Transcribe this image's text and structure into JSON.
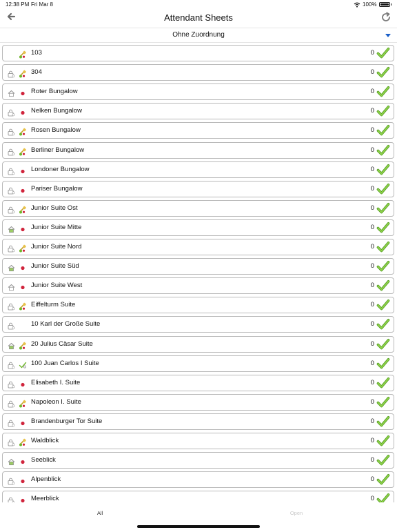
{
  "status_bar": {
    "time": "12:38 PM",
    "date": "Fri Mar 8",
    "battery": "100%"
  },
  "header": {
    "title": "Attendant Sheets"
  },
  "filter": {
    "selected": "Ohne Zuordnung"
  },
  "rooms": [
    {
      "name": "103",
      "count": "0",
      "status": "none",
      "type": "brush"
    },
    {
      "name": "304",
      "count": "0",
      "status": "lock",
      "type": "brush"
    },
    {
      "name": "Roter Bungalow",
      "count": "0",
      "status": "house",
      "type": "dot"
    },
    {
      "name": "Nelken Bungalow",
      "count": "0",
      "status": "lock",
      "type": "dot"
    },
    {
      "name": "Rosen Bungalow",
      "count": "0",
      "status": "lock",
      "type": "brush"
    },
    {
      "name": "Berliner Bungalow",
      "count": "0",
      "status": "lock",
      "type": "brush"
    },
    {
      "name": "Londoner Bungalow",
      "count": "0",
      "status": "lock",
      "type": "dot"
    },
    {
      "name": "Pariser Bungalow",
      "count": "0",
      "status": "lock",
      "type": "dot"
    },
    {
      "name": "Junior Suite Ost",
      "count": "0",
      "status": "lock",
      "type": "brush"
    },
    {
      "name": "Junior Suite Mitte",
      "count": "0",
      "status": "house-green",
      "type": "dot"
    },
    {
      "name": "Junior Suite Nord",
      "count": "0",
      "status": "lock",
      "type": "brush"
    },
    {
      "name": "Junior Suite Süd",
      "count": "0",
      "status": "house-green",
      "type": "dot"
    },
    {
      "name": "Junior Suite West",
      "count": "0",
      "status": "house",
      "type": "dot"
    },
    {
      "name": "Eiffelturm Suite",
      "count": "0",
      "status": "lock",
      "type": "brush"
    },
    {
      "name": "10 Karl der Große Suite",
      "count": "0",
      "status": "lock",
      "type": "none"
    },
    {
      "name": "20 Julius Cäsar Suite",
      "count": "0",
      "status": "house-green",
      "type": "brush"
    },
    {
      "name": "100 Juan Carlos I Suite",
      "count": "0",
      "status": "lock",
      "type": "inspect"
    },
    {
      "name": "Elisabeth I. Suite",
      "count": "0",
      "status": "lock",
      "type": "dot"
    },
    {
      "name": "Napoleon I. Suite",
      "count": "0",
      "status": "lock",
      "type": "brush"
    },
    {
      "name": "Brandenburger Tor Suite",
      "count": "0",
      "status": "lock",
      "type": "dot"
    },
    {
      "name": "Waldblick",
      "count": "0",
      "status": "lock",
      "type": "brush"
    },
    {
      "name": "Seeblick",
      "count": "0",
      "status": "house-green",
      "type": "dot"
    },
    {
      "name": "Alpenblick",
      "count": "0",
      "status": "lock",
      "type": "dot"
    },
    {
      "name": "Meerblick",
      "count": "0",
      "status": "lock",
      "type": "dot"
    }
  ],
  "tabs": {
    "all": "All",
    "open": "Open"
  },
  "colors": {
    "check_green": "#6fb62b",
    "accent_blue": "#1a5fc8",
    "dot_red": "#d0243c",
    "row_border": "#b9b9b9"
  },
  "icons": {
    "back": "arrow-left-icon",
    "refresh": "refresh-icon",
    "dropdown": "caret-down-icon",
    "done": "checkmark-icon"
  }
}
